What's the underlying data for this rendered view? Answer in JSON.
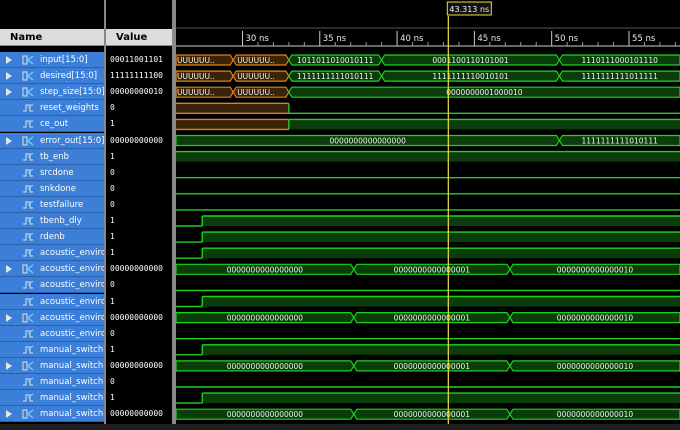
{
  "headers": {
    "name": "Name",
    "value": "Value"
  },
  "cursor": {
    "label": "43.313 ns",
    "time": 43.313
  },
  "timeline": {
    "start_ns": 25.7,
    "end_ns": 58.3,
    "ticks": [
      {
        "t": 30,
        "label": "30 ns"
      },
      {
        "t": 35,
        "label": "35 ns"
      },
      {
        "t": 40,
        "label": "40 ns"
      },
      {
        "t": 45,
        "label": "45 ns"
      },
      {
        "t": 50,
        "label": "50 ns"
      },
      {
        "t": 55,
        "label": "55 ns"
      }
    ]
  },
  "colors": {
    "wave": "#1fd11f",
    "bus_fill": "#0b3d0b",
    "undefined": "#e0801a",
    "cursor": "#f0e040",
    "row_bg": "#3b7fd8",
    "text": "#ffffff"
  },
  "signals": [
    {
      "name": "input[15:0]",
      "value": "00011001101",
      "type": "bus",
      "expandable": true,
      "segments": [
        {
          "end": 29.4,
          "label": "UUUUUU..",
          "undef": true
        },
        {
          "end": 33.0,
          "label": "UUUUUU..",
          "undef": true
        },
        {
          "end": 39.0,
          "label": "1011011010010111"
        },
        {
          "end": 50.5,
          "label": "0001100110101001"
        },
        {
          "end": 60,
          "label": "1110111000101110"
        }
      ]
    },
    {
      "name": "desired[15:0]",
      "value": "11111111100",
      "type": "bus",
      "expandable": true,
      "segments": [
        {
          "end": 29.4,
          "label": "UUUUUU..",
          "undef": true
        },
        {
          "end": 33.0,
          "label": "UUUUUU..",
          "undef": true
        },
        {
          "end": 39.0,
          "label": "1111111111010111"
        },
        {
          "end": 50.5,
          "label": "1111111110010101"
        },
        {
          "end": 60,
          "label": "1111111111011111"
        }
      ]
    },
    {
      "name": "step_size[15:0]",
      "value": "00000000010",
      "type": "bus",
      "expandable": true,
      "segments": [
        {
          "end": 29.4,
          "label": "UUUUUU..",
          "undef": true
        },
        {
          "end": 33.0,
          "label": "UUUUUU..",
          "undef": true
        },
        {
          "end": 60,
          "label": "0000000001000010"
        }
      ]
    },
    {
      "name": "reset_weights",
      "value": "0",
      "type": "bit",
      "levels": [
        {
          "end": 33.0,
          "level": "u"
        },
        {
          "end": 60,
          "level": 0
        }
      ]
    },
    {
      "name": "ce_out",
      "value": "1",
      "type": "bit",
      "levels": [
        {
          "end": 33.0,
          "level": "u"
        },
        {
          "end": 60,
          "level": 1
        }
      ]
    },
    {
      "name": "error_out[15:0]",
      "value": "00000000000",
      "type": "bus",
      "expandable": true,
      "segments": [
        {
          "end": 50.5,
          "label": "0000000000000000"
        },
        {
          "end": 60,
          "label": "1111111111010111"
        }
      ]
    },
    {
      "name": "tb_enb",
      "value": "1",
      "type": "bit",
      "levels": [
        {
          "end": 60,
          "level": 1
        }
      ],
      "filled": true
    },
    {
      "name": "srcdone",
      "value": "0",
      "type": "bit",
      "levels": [
        {
          "end": 60,
          "level": 0
        }
      ]
    },
    {
      "name": "snkdone",
      "value": "0",
      "type": "bit",
      "levels": [
        {
          "end": 60,
          "level": 0
        }
      ]
    },
    {
      "name": "testfailure",
      "value": "0",
      "type": "bit",
      "levels": [
        {
          "end": 60,
          "level": 0
        }
      ]
    },
    {
      "name": "tbenb_dly",
      "value": "1",
      "type": "bit",
      "levels": [
        {
          "end": 27.4,
          "level": 0
        },
        {
          "end": 60,
          "level": 1
        }
      ]
    },
    {
      "name": "rdenb",
      "value": "1",
      "type": "bit",
      "levels": [
        {
          "end": 27.4,
          "level": 0
        },
        {
          "end": 60,
          "level": 1
        }
      ]
    },
    {
      "name": "acoustic_envirc",
      "value": "1",
      "type": "bit",
      "levels": [
        {
          "end": 27.4,
          "level": 0
        },
        {
          "end": 60,
          "level": 1
        }
      ]
    },
    {
      "name": "acoustic_envirc",
      "value": "00000000000",
      "type": "bus",
      "expandable": true,
      "segments": [
        {
          "end": 37.2,
          "label": "0000000000000000"
        },
        {
          "end": 47.3,
          "label": "0000000000000001"
        },
        {
          "end": 60,
          "label": "0000000000000010"
        }
      ]
    },
    {
      "name": "acoustic_envirc",
      "value": "0",
      "type": "bit",
      "levels": [
        {
          "end": 60,
          "level": 0
        }
      ]
    },
    {
      "name": "acoustic_envirc",
      "value": "1",
      "type": "bit",
      "levels": [
        {
          "end": 27.4,
          "level": 0
        },
        {
          "end": 60,
          "level": 1
        }
      ]
    },
    {
      "name": "acoustic_envirc",
      "value": "00000000000",
      "type": "bus",
      "expandable": true,
      "segments": [
        {
          "end": 37.2,
          "label": "0000000000000000"
        },
        {
          "end": 47.3,
          "label": "0000000000000001"
        },
        {
          "end": 60,
          "label": "0000000000000010"
        }
      ]
    },
    {
      "name": "acoustic_envirc",
      "value": "0",
      "type": "bit",
      "levels": [
        {
          "end": 60,
          "level": 0
        }
      ]
    },
    {
      "name": "manual_switch",
      "value": "1",
      "type": "bit",
      "levels": [
        {
          "end": 27.4,
          "level": 0
        },
        {
          "end": 60,
          "level": 1
        }
      ]
    },
    {
      "name": "manual_switch",
      "value": "00000000000",
      "type": "bus",
      "expandable": true,
      "segments": [
        {
          "end": 37.2,
          "label": "0000000000000000"
        },
        {
          "end": 47.3,
          "label": "0000000000000001"
        },
        {
          "end": 60,
          "label": "0000000000000010"
        }
      ]
    },
    {
      "name": "manual_switch",
      "value": "0",
      "type": "bit",
      "levels": [
        {
          "end": 60,
          "level": 0
        }
      ]
    },
    {
      "name": "manual_switch",
      "value": "1",
      "type": "bit",
      "levels": [
        {
          "end": 27.4,
          "level": 0
        },
        {
          "end": 60,
          "level": 1
        }
      ]
    },
    {
      "name": "manual_switch",
      "value": "00000000000",
      "type": "bus",
      "expandable": true,
      "segments": [
        {
          "end": 37.2,
          "label": "0000000000000000"
        },
        {
          "end": 47.3,
          "label": "0000000000000001"
        },
        {
          "end": 60,
          "label": "0000000000000010"
        }
      ]
    }
  ]
}
